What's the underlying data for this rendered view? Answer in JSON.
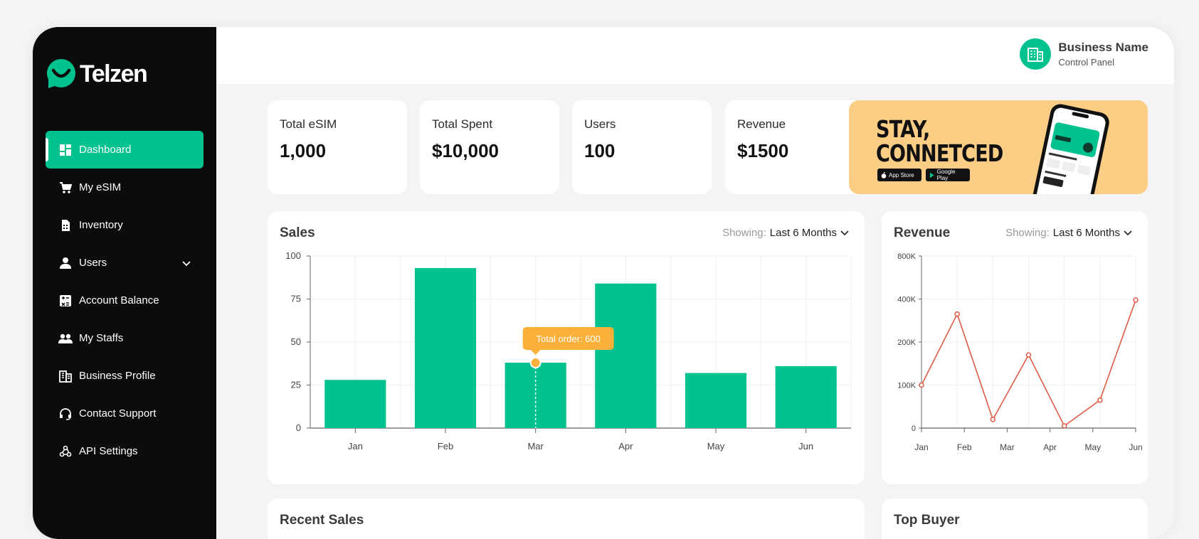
{
  "brand": {
    "name": "Telzen",
    "accent": "#00c28f",
    "sidebar_bg": "#0c0c0c"
  },
  "sidebar": {
    "items": [
      {
        "label": "Dashboard",
        "icon": "dashboard-icon",
        "active": true
      },
      {
        "label": "My eSIM",
        "icon": "cart-icon"
      },
      {
        "label": "Inventory",
        "icon": "sim-card-icon"
      },
      {
        "label": "Users",
        "icon": "user-icon",
        "has_submenu": true
      },
      {
        "label": "Account Balance",
        "icon": "calculator-icon"
      },
      {
        "label": "My Staffs",
        "icon": "group-icon"
      },
      {
        "label": "Business Profile",
        "icon": "building-icon"
      },
      {
        "label": "Contact Support",
        "icon": "headset-icon"
      },
      {
        "label": "API Settings",
        "icon": "webhook-icon"
      }
    ]
  },
  "header": {
    "business_name": "Business Name",
    "subtitle": "Control Panel"
  },
  "stats": [
    {
      "label": "Total eSIM",
      "value": "1,000"
    },
    {
      "label": "Total Spent",
      "value": "$10,000"
    },
    {
      "label": "Users",
      "value": "100"
    },
    {
      "label": "Revenue",
      "value": "$1500"
    }
  ],
  "promo": {
    "title_line1": "STAY,",
    "title_line2": "CONNETCED",
    "app_store": "App Store",
    "google_play": "Google Play",
    "bg_color": "#fbcd85"
  },
  "sales_panel": {
    "title": "Sales",
    "showing_label": "Showing:",
    "range": "Last 6 Months"
  },
  "revenue_panel": {
    "title": "Revenue",
    "showing_label": "Showing:",
    "range": "Last 6 Months"
  },
  "bottom_panels": {
    "left_title": "Recent Sales",
    "right_title": "Top Buyer"
  },
  "chart_data": [
    {
      "type": "bar",
      "title": "Sales",
      "categories": [
        "Jan",
        "Feb",
        "Mar",
        "Apr",
        "May",
        "Jun"
      ],
      "values": [
        28,
        93,
        38,
        84,
        32,
        36
      ],
      "ylim": [
        0,
        100
      ],
      "yticks": [
        0,
        25,
        50,
        75,
        100
      ],
      "grid": true,
      "color": "#00c28f",
      "tooltip": {
        "category": "Mar",
        "text": "Total order: 600",
        "color": "#fbb03b"
      }
    },
    {
      "type": "line",
      "title": "Revenue",
      "x": [
        0,
        1,
        2,
        3,
        4,
        5,
        6
      ],
      "xtick_labels": [
        "Jan",
        "Feb",
        "Mar",
        "Apr",
        "May",
        "Jun"
      ],
      "values": [
        100,
        330,
        20,
        170,
        5,
        65,
        395
      ],
      "y_display_levels": [
        0,
        100,
        200,
        400,
        800
      ],
      "ytick_labels": [
        "0",
        "100K",
        "200K",
        "400K",
        "800K"
      ],
      "grid": true,
      "color": "#e05a44"
    }
  ]
}
